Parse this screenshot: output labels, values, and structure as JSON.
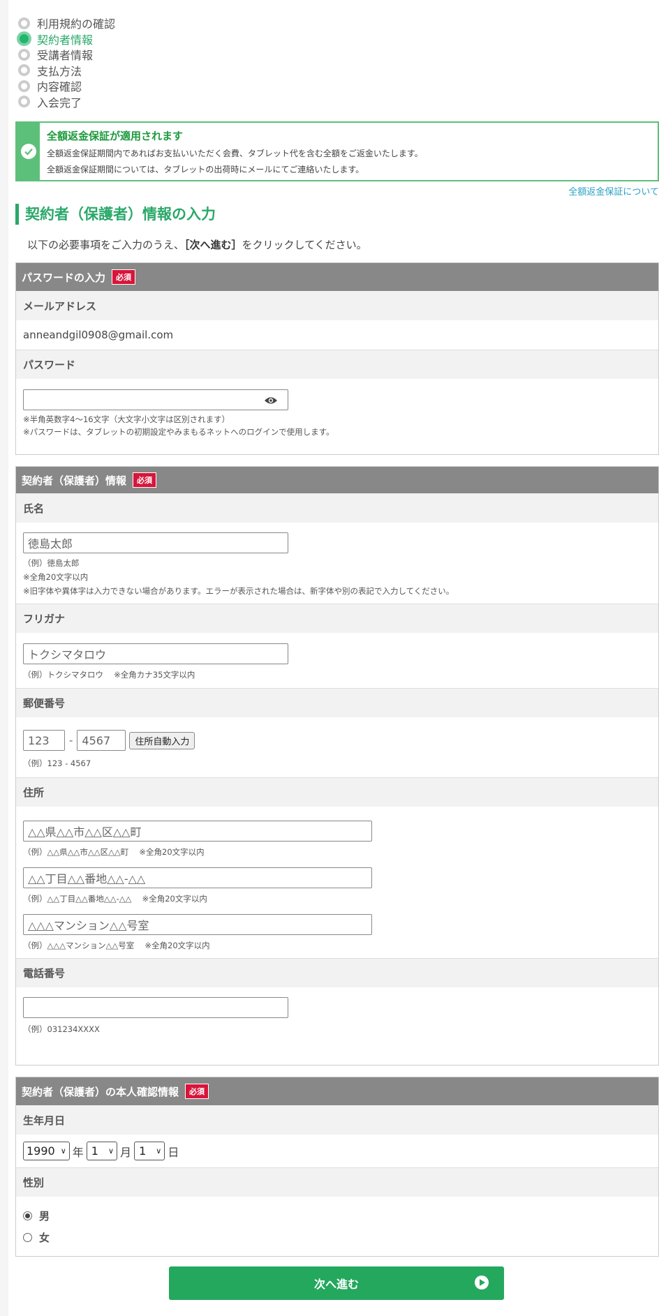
{
  "steps": [
    {
      "label": "利用規約の確認",
      "active": false
    },
    {
      "label": "契約者情報",
      "active": true
    },
    {
      "label": "受講者情報",
      "active": false
    },
    {
      "label": "支払方法",
      "active": false
    },
    {
      "label": "内容確認",
      "active": false
    },
    {
      "label": "入会完了",
      "active": false
    }
  ],
  "guarantee": {
    "title": "全額返金保証が適用されます",
    "line1": "全額返金保証期間内であればお支払いいただく会費、タブレット代を含む全額をご返金いたします。",
    "line2": "全額返金保証期間については、タブレットの出荷時にメールにてご連絡いたします。",
    "link": "全額返金保証について"
  },
  "heading": "契約者（保護者）情報の入力",
  "intro": {
    "before": "以下の必要事項をご入力のうえ、",
    "bold": "［次へ進む］",
    "after": "をクリックしてください。"
  },
  "required_badge": "必須",
  "password_section": {
    "title": "パスワードの入力",
    "email_label": "メールアドレス",
    "email_value": "anneandgil0908@gmail.com",
    "password_label": "パスワード",
    "password_value": "",
    "note1": "※半角英数字4～16文字（大文字小文字は区別されます）",
    "note2": "※パスワードは、タブレットの初期設定やみまもるネットへのログインで使用します。"
  },
  "contractor_section": {
    "title": "契約者（保護者）情報",
    "name_label": "氏名",
    "name_placeholder": "徳島太郎",
    "name_note1": "（例）徳島太郎",
    "name_note2": "※全角20文字以内",
    "name_note3": "※旧字体や異体字は入力できない場合があります。エラーが表示された場合は、新字体や別の表記で入力してください。",
    "kana_label": "フリガナ",
    "kana_placeholder": "トクシマタロウ",
    "kana_note": "（例）トクシマタロウ　 ※全角カナ35文字以内",
    "zip_label": "郵便番号",
    "zip1_placeholder": "123",
    "zip2_placeholder": "4567",
    "zip_dash": "-",
    "zip_button": "住所自動入力",
    "zip_note": "（例）123 - 4567",
    "address_label": "住所",
    "addr1_placeholder": "△△県△△市△△区△△町",
    "addr1_note": "（例）△△県△△市△△区△△町　 ※全角20文字以内",
    "addr2_placeholder": "△△丁目△△番地△△-△△",
    "addr2_note": "（例）△△丁目△△番地△△-△△　 ※全角20文字以内",
    "addr3_placeholder": "△△△マンション△△号室",
    "addr3_note": "（例）△△△マンション△△号室　 ※全角20文字以内",
    "phone_label": "電話番号",
    "phone_value": "",
    "phone_note": "（例）031234XXXX"
  },
  "identity_section": {
    "title": "契約者（保護者）の本人確認情報",
    "birth_label": "生年月日",
    "year": "1990",
    "year_unit": "年",
    "month": "1",
    "month_unit": "月",
    "day": "1",
    "day_unit": "日",
    "gender_label": "性別",
    "male": "男",
    "female": "女",
    "selected_gender": "男"
  },
  "next_button": "次へ進む",
  "colors": {
    "accent": "#2aa86a",
    "required": "#d8143a",
    "section_header": "#888888"
  }
}
